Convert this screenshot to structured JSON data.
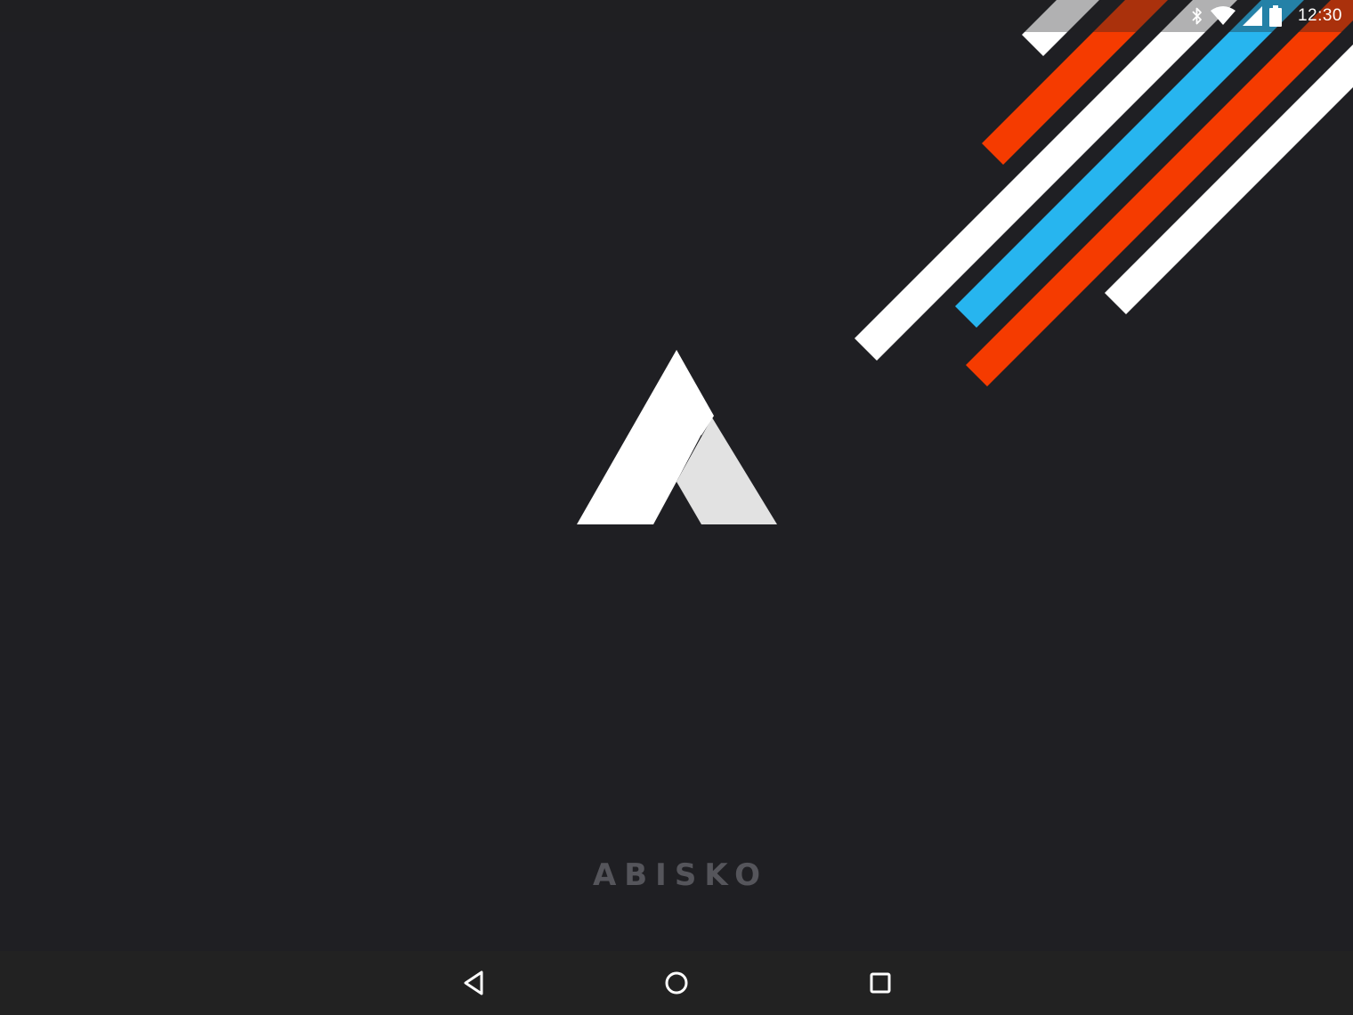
{
  "app": {
    "brand_name": "ABISKO"
  },
  "status_bar": {
    "time": "12:30",
    "icons": [
      "bluetooth-icon",
      "wifi-icon",
      "cell-signal-icon",
      "battery-icon"
    ]
  },
  "nav_bar": {
    "buttons": [
      "back-button",
      "home-button",
      "recents-button"
    ]
  },
  "colors": {
    "background": "#1f1f23",
    "stripe_orange": "#f53b00",
    "stripe_blue": "#27b5ef",
    "stripe_white": "#ffffff",
    "logo_light": "#ffffff",
    "logo_shade": "#e2e2e2",
    "brand_text": "#55555b",
    "nav_bar": "#222222"
  }
}
